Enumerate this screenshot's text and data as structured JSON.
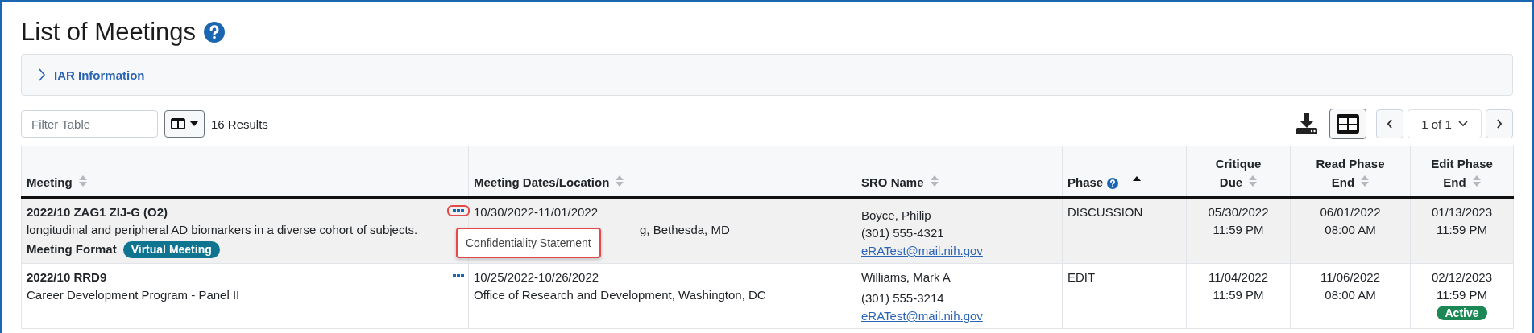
{
  "title": "List of Meetings",
  "iar_panel": {
    "label": "IAR Information",
    "expanded": false
  },
  "toolbar": {
    "filter": {
      "placeholder": "Filter Table"
    },
    "results": "16 Results",
    "pager": "1 of 1"
  },
  "table": {
    "columns": [
      {
        "label": "Meeting",
        "sorted": false,
        "centered": false
      },
      {
        "label": "Meeting Dates/Location",
        "sorted": false,
        "centered": false
      },
      {
        "label": "SRO Name",
        "sorted": false,
        "centered": false
      },
      {
        "label": "Phase",
        "sorted": true,
        "centered": false,
        "help": true
      },
      {
        "label": "Critique Due",
        "sorted": false,
        "centered": true
      },
      {
        "label": "Read Phase End",
        "sorted": false,
        "centered": true
      },
      {
        "label": "Edit Phase End",
        "sorted": false,
        "centered": true
      }
    ],
    "rows": [
      {
        "highlighted": true,
        "menu_open": true,
        "menu_item": "Confidentiality Statement",
        "meeting": "2022/10 ZAG1 ZIJ-G (O2)",
        "description": "longitudinal and peripheral AD biomarkers in a diverse cohort of subjects.",
        "format_label": "Meeting Format",
        "format_badge": "Virtual Meeting",
        "dates": "10/30/2022-11/01/2022",
        "location": "g, Bethesda, MD",
        "sro_name": "Boyce, Philip",
        "sro_phone": "(301) 555-4321",
        "sro_email": "eRATest@mail.nih.gov",
        "phase": "DISCUSSION",
        "critique_due": [
          "05/30/2022",
          "11:59 PM"
        ],
        "read_end": [
          "06/01/2022",
          "08:00 AM"
        ],
        "edit_end": [
          "01/13/2023",
          "11:59 PM"
        ]
      },
      {
        "highlighted": false,
        "menu_open": false,
        "meeting": "2022/10 RRD9",
        "description": "Career Development Program - Panel II",
        "dates": "10/25/2022-10/26/2022",
        "location": "Office of Research and Development, Washington, DC",
        "sro_name": "Williams, Mark A",
        "sro_phone": "(301) 555-3214",
        "sro_email": "eRATest@mail.nih.gov",
        "phase": "EDIT",
        "critique_due": [
          "11/04/2022",
          "11:59 PM"
        ],
        "read_end": [
          "11/06/2022",
          "08:00 AM"
        ],
        "edit_end": [
          "02/12/2023",
          "11:59 PM"
        ],
        "status_badge": "Active"
      }
    ]
  }
}
